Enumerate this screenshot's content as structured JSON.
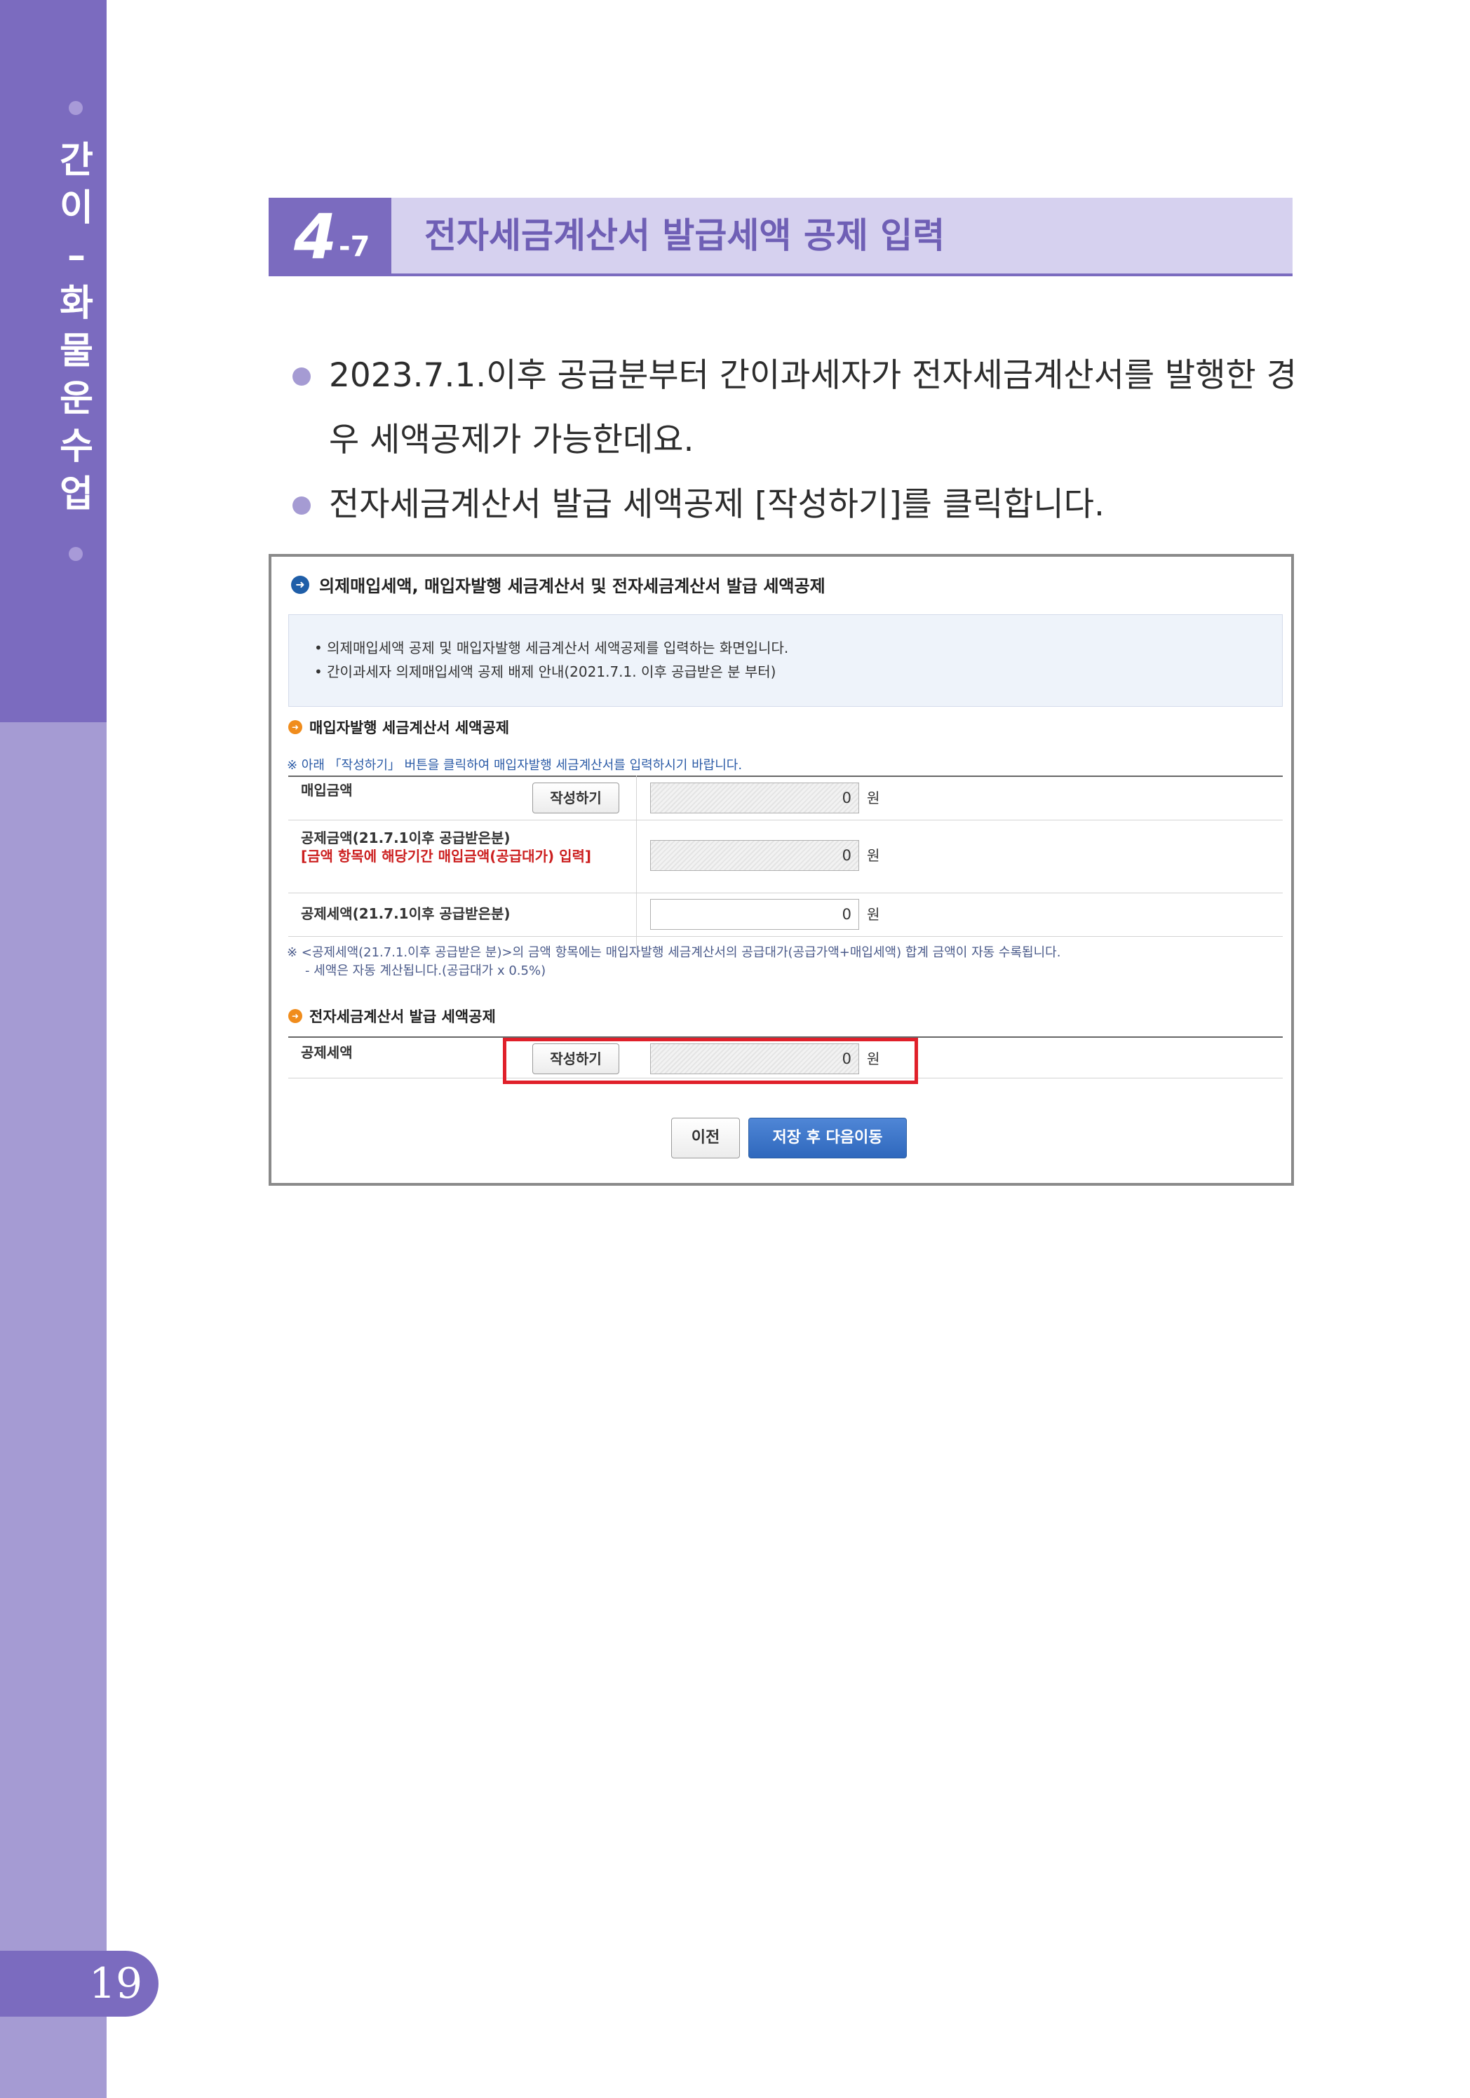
{
  "sidebar": {
    "chapter_chars": [
      "간",
      "이",
      "–",
      "화",
      "물",
      "운",
      "수",
      "업"
    ],
    "page_number": "19"
  },
  "section": {
    "number_main": "4",
    "number_sub": "-7",
    "title": "전자세금계산서 발급세액 공제 입력"
  },
  "bullets": [
    "2023.7.1.이후 공급분부터 간이과세자가 전자세금계산서를 발행한 경우 세액공제가 가능한데요.",
    "전자세금계산서 발급 세액공제 [작성하기]를 클릭합니다."
  ],
  "screen": {
    "title": "의제매입세액, 매입자발행 세금계산서 및 전자세금계산서 발급 세액공제",
    "info_lines": [
      "• 의제매입세액 공제 및 매입자발행 세금계산서 세액공제를 입력하는 화면입니다.",
      "• 간이과세자 의제매입세액 공제 배제 안내(2021.7.1. 이후 공급받은 분 부터)"
    ],
    "buyer_section": {
      "title": "매입자발행 세금계산서 세액공제",
      "note": "※ 아래 「작성하기」 버튼을 클릭하여 매입자발행 세금계산서를 입력하시기 바랍니다.",
      "rows": [
        {
          "label": "매입금액",
          "button": "작성하기",
          "value": "0",
          "unit": "원"
        },
        {
          "label": "공제금액(21.7.1이후 공급받은분)",
          "label_red": "[금액 항목에 해당기간 매입금액(공급대가) 입력]",
          "value": "0",
          "unit": "원"
        },
        {
          "label": "공제세액(21.7.1이후 공급받은분)",
          "value": "0",
          "unit": "원"
        }
      ],
      "footnote_1": "※ <공제세액(21.7.1.이후 공급받은 분)>의 금액 항목에는 매입자발행 세금계산서의 공급대가(공급가액+매입세액) 합계 금액이 자동 수록됩니다.",
      "footnote_2": "- 세액은 자동 계산됩니다.(공급대가 x 0.5%)"
    },
    "etax_section": {
      "title": "전자세금계산서 발급 세액공제",
      "row": {
        "label": "공제세액",
        "button": "작성하기",
        "value": "0",
        "unit": "원"
      }
    },
    "prev_button": "이전",
    "next_button": "저장 후 다음이동"
  }
}
